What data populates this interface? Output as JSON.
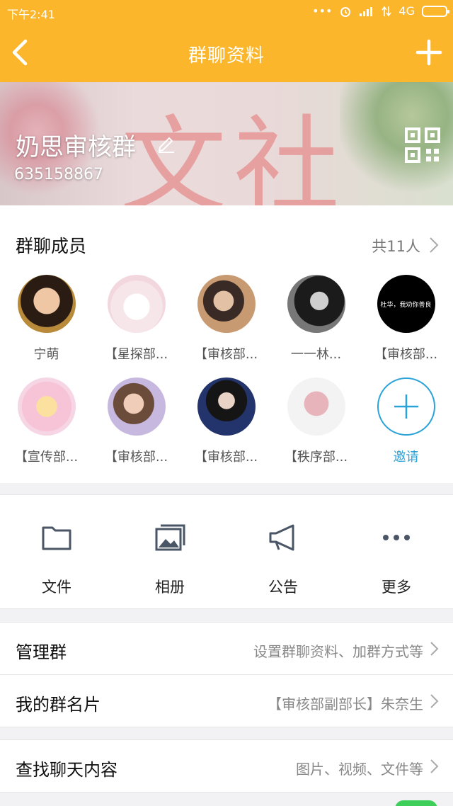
{
  "status_bar": {
    "time": "下午2:41",
    "network": "4G"
  },
  "header": {
    "title": "群聊资料"
  },
  "group": {
    "name": "奶思审核群",
    "id": "635158867",
    "banner_text": "文社"
  },
  "members": {
    "title": "群聊成员",
    "count_text": "共11人",
    "list": [
      {
        "name": "宁萌"
      },
      {
        "name": "【星探部..."
      },
      {
        "name": "【审核部..."
      },
      {
        "name": "一一林..."
      },
      {
        "name": "【审核部...",
        "avatar_text": "杜华，我劝你善良"
      },
      {
        "name": "【宣传部..."
      },
      {
        "name": "【审核部..."
      },
      {
        "name": "【审核部..."
      },
      {
        "name": "【秩序部..."
      }
    ],
    "invite_label": "邀请"
  },
  "actions": [
    {
      "label": "文件",
      "icon": "folder-icon"
    },
    {
      "label": "相册",
      "icon": "album-icon"
    },
    {
      "label": "公告",
      "icon": "megaphone-icon"
    },
    {
      "label": "更多",
      "icon": "more-icon"
    }
  ],
  "settings": {
    "manage": {
      "label": "管理群",
      "value": "设置群聊资料、加群方式等"
    },
    "card": {
      "label": "我的群名片",
      "value": "【审核部副部长】朱奈生"
    },
    "search": {
      "label": "查找聊天内容",
      "value": "图片、视频、文件等"
    }
  },
  "colors": {
    "accent": "#fbb62b",
    "link": "#2aa3d9"
  }
}
